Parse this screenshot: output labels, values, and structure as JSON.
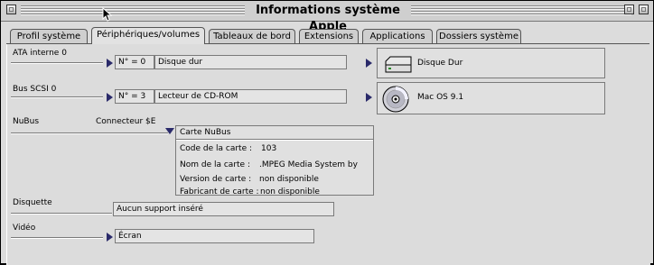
{
  "window": {
    "title": "Informations système Apple"
  },
  "tabs": [
    {
      "label": "Profil système",
      "active": false
    },
    {
      "label": "Périphériques/volumes",
      "active": true
    },
    {
      "label": "Tableaux de bord",
      "active": false
    },
    {
      "label": "Extensions",
      "active": false
    },
    {
      "label": "Applications",
      "active": false
    },
    {
      "label": "Dossiers système",
      "active": false
    }
  ],
  "ata": {
    "section_label": "ATA interne 0",
    "number": "N° = 0",
    "device": "Disque dur",
    "volume_name": "Disque Dur",
    "icon": "hard-drive-icon"
  },
  "scsi": {
    "section_label": "Bus SCSI 0",
    "number": "N° = 3",
    "device": "Lecteur de CD-ROM",
    "volume_name": "Mac OS 9.1",
    "icon": "cd-rom-disc-icon"
  },
  "nubus": {
    "section_label": "NuBus",
    "connector": "Connecteur $E",
    "card_title": "Carte NuBus",
    "fields": [
      {
        "label": "Code de la carte :",
        "value": "103"
      },
      {
        "label": "Nom de la carte :",
        "value": ".MPEG Media System by"
      },
      {
        "label": "Version de carte :",
        "value": "non disponible"
      },
      {
        "label": "Fabricant de carte :",
        "value": "non disponible"
      }
    ]
  },
  "floppy": {
    "section_label": "Disquette",
    "value": "Aucun support inséré"
  },
  "video": {
    "section_label": "Vidéo",
    "value": "Écran"
  },
  "colors": {
    "window_bg": "#dcdcdc",
    "disclosure_triangle": "#2a2a6a"
  }
}
